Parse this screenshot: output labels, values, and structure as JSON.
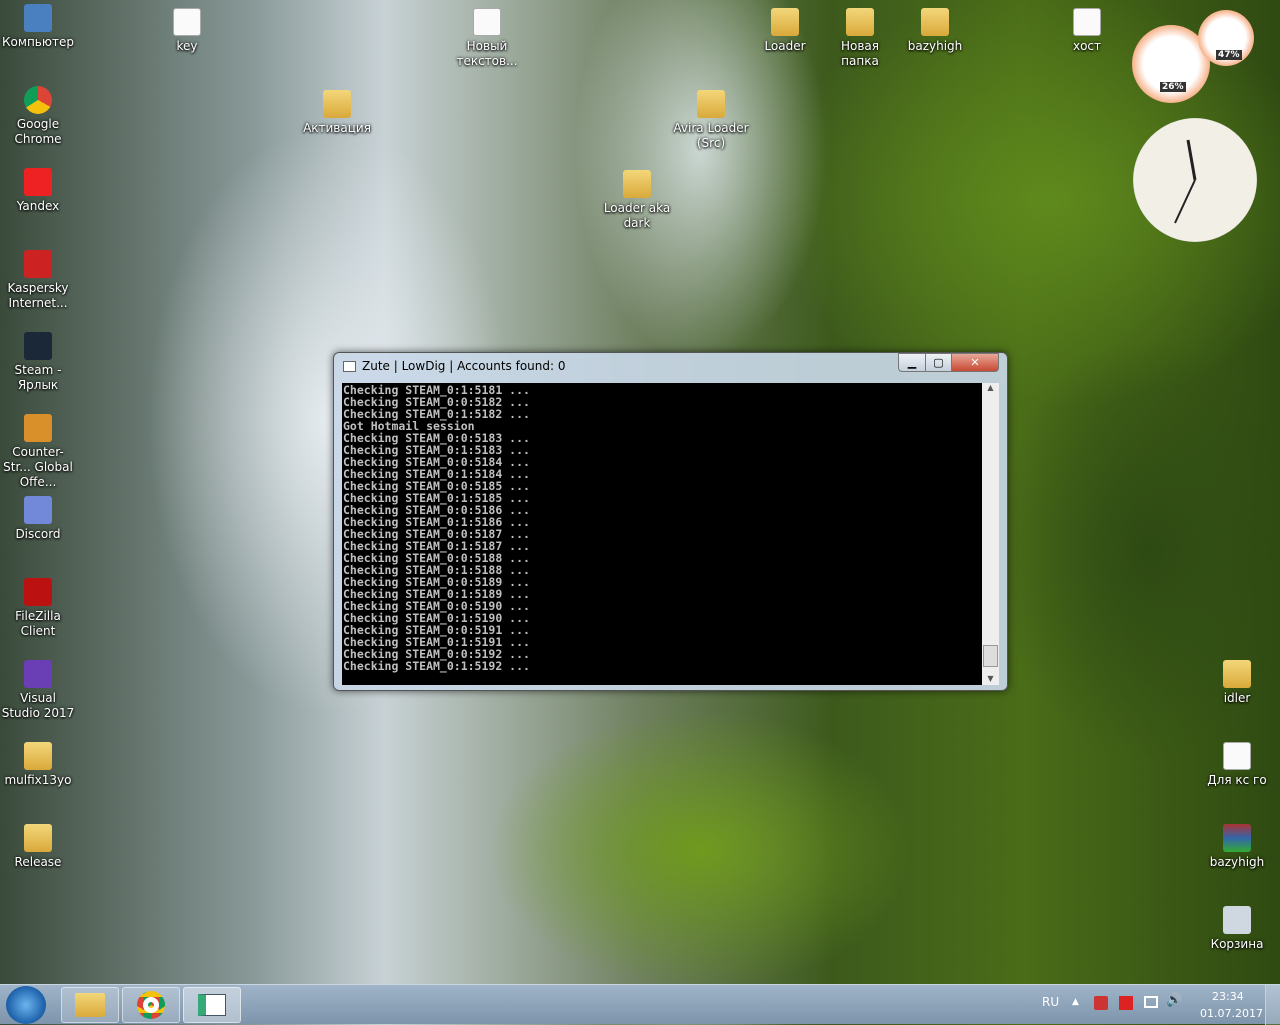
{
  "desktop_icons": [
    {
      "label": "Компьютер",
      "type": "computer"
    },
    {
      "label": "Google Chrome",
      "type": "chrome"
    },
    {
      "label": "Yandex",
      "type": "yandex"
    },
    {
      "label": "Kaspersky Internet...",
      "type": "kaspersky"
    },
    {
      "label": "Steam - Ярлык",
      "type": "steam"
    },
    {
      "label": "Counter-Str... Global Offe...",
      "type": "csgo"
    },
    {
      "label": "Discord",
      "type": "discord"
    },
    {
      "label": "FileZilla Client",
      "type": "filezilla"
    },
    {
      "label": "Visual Studio 2017",
      "type": "vs"
    },
    {
      "label": "mulfix13yo",
      "type": "folder"
    },
    {
      "label": "Release",
      "type": "folder"
    },
    {
      "label": "key",
      "type": "file"
    },
    {
      "label": "Новый текстов...",
      "type": "file"
    },
    {
      "label": "Активация",
      "type": "folder"
    },
    {
      "label": "Loader",
      "type": "folder"
    },
    {
      "label": "Новая папка",
      "type": "folder"
    },
    {
      "label": "bazyhigh",
      "type": "folder"
    },
    {
      "label": "хост",
      "type": "file"
    },
    {
      "label": "Avira Loader (Src)",
      "type": "folder"
    },
    {
      "label": "Loader aka dark",
      "type": "folder"
    },
    {
      "label": "idler",
      "type": "folder"
    },
    {
      "label": "Для кс го",
      "type": "file"
    },
    {
      "label": "bazyhigh",
      "type": "archive"
    },
    {
      "label": "Корзина",
      "type": "recycle"
    }
  ],
  "gadgets": {
    "cpu": "26%",
    "ram": "47%"
  },
  "window": {
    "title": "Zute | LowDig | Accounts found: 0",
    "min": "▁",
    "max": "▢",
    "close": "✕",
    "lines": [
      "Checking STEAM_0:1:5181 ...",
      "Checking STEAM_0:0:5182 ...",
      "Checking STEAM_0:1:5182 ...",
      "Got Hotmail session",
      "Checking STEAM_0:0:5183 ...",
      "Checking STEAM_0:1:5183 ...",
      "Checking STEAM_0:0:5184 ...",
      "Checking STEAM_0:1:5184 ...",
      "Checking STEAM_0:0:5185 ...",
      "Checking STEAM_0:1:5185 ...",
      "Checking STEAM_0:0:5186 ...",
      "Checking STEAM_0:1:5186 ...",
      "Checking STEAM_0:0:5187 ...",
      "Checking STEAM_0:1:5187 ...",
      "Checking STEAM_0:0:5188 ...",
      "Checking STEAM_0:1:5188 ...",
      "Checking STEAM_0:0:5189 ...",
      "Checking STEAM_0:1:5189 ...",
      "Checking STEAM_0:0:5190 ...",
      "Checking STEAM_0:1:5190 ...",
      "Checking STEAM_0:0:5191 ...",
      "Checking STEAM_0:1:5191 ...",
      "Checking STEAM_0:0:5192 ...",
      "Checking STEAM_0:1:5192 ..."
    ]
  },
  "taskbar": {
    "lang": "RU",
    "time": "23:34",
    "date": "01.07.2017"
  }
}
